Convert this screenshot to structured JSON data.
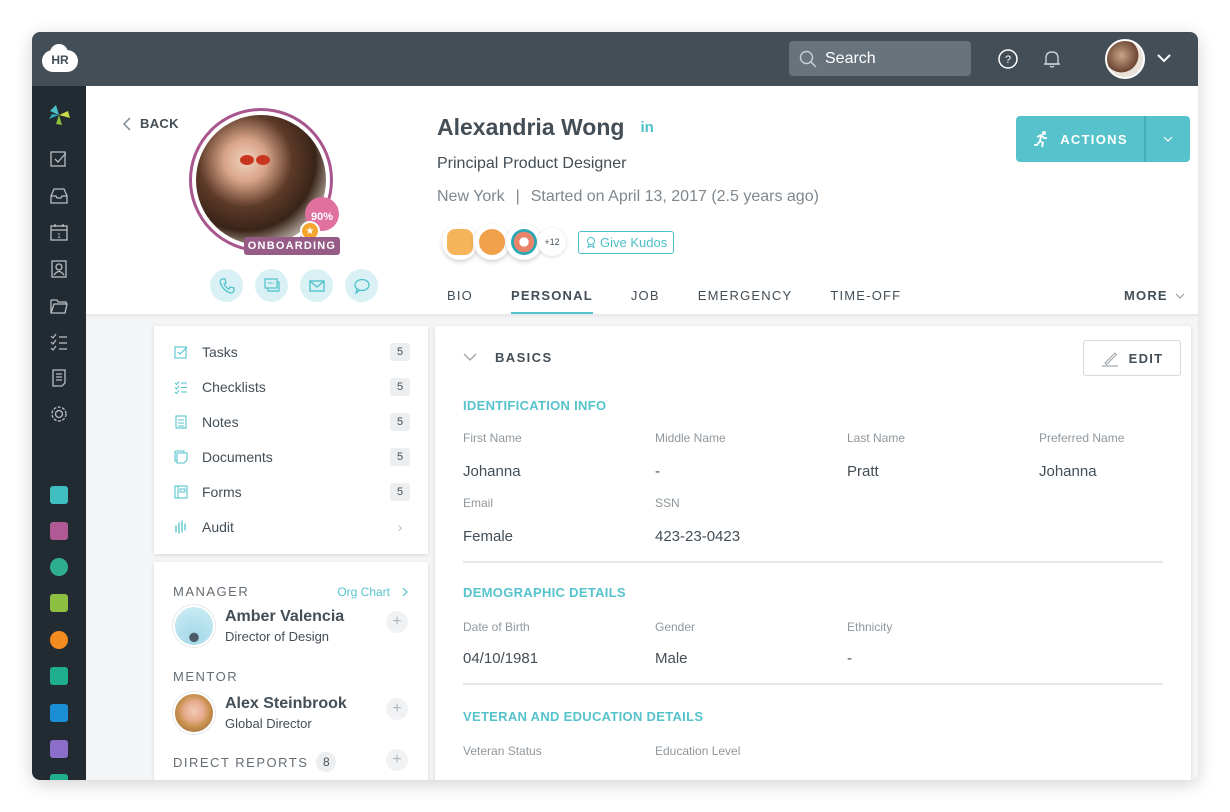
{
  "topbar": {
    "logo_text": "HR",
    "search_placeholder": "Search",
    "icons": [
      "search-icon",
      "help-icon",
      "bell-icon",
      "user-avatar",
      "chevron-down-icon"
    ]
  },
  "sidebar": {
    "nav_icons": [
      "logo-pinwheel-icon",
      "tasks-icon",
      "inbox-icon",
      "calendar-icon",
      "contacts-icon",
      "folder-icon",
      "checklist-icon",
      "document-icon",
      "settings-icon"
    ],
    "apps": [
      {
        "name": "team-app-icon",
        "color": "#3fbfbf"
      },
      {
        "name": "badge-app-icon",
        "color": "#b05a95"
      },
      {
        "name": "award-app-icon",
        "color": "#2fae8e"
      },
      {
        "name": "travel-app-icon",
        "color": "#8cbf3f"
      },
      {
        "name": "health-app-icon",
        "color": "#f38b1f"
      },
      {
        "name": "monitor-app-icon",
        "color": "#1fae8e"
      },
      {
        "name": "search-app-icon",
        "color": "#1b8fd6"
      },
      {
        "name": "report-app-icon",
        "color": "#8a6ec9"
      }
    ]
  },
  "profile": {
    "back_label": "BACK",
    "completion": "90%",
    "status_badge": "ONBOARDING",
    "name": "Alexandria Wong",
    "linkedin": "in",
    "job_title": "Principal Product Designer",
    "location": "New York",
    "separator": "|",
    "start_info": "Started on April 13, 2017 (2.5 years ago)",
    "kudos_more": "+12",
    "give_kudos_label": "Give Kudos",
    "contact_buttons": [
      "phone-icon",
      "chat-icon",
      "mail-icon",
      "message-icon"
    ],
    "actions_label": "ACTIONS"
  },
  "tabs": [
    {
      "label": "BIO",
      "active": false
    },
    {
      "label": "PERSONAL",
      "active": true
    },
    {
      "label": "JOB",
      "active": false
    },
    {
      "label": "EMERGENCY",
      "active": false
    },
    {
      "label": "TIME-OFF",
      "active": false
    }
  ],
  "more_label": "MORE",
  "links": [
    {
      "label": "Tasks",
      "count": "5"
    },
    {
      "label": "Checklists",
      "count": "5"
    },
    {
      "label": "Notes",
      "count": "5"
    },
    {
      "label": "Documents",
      "count": "5"
    },
    {
      "label": "Forms",
      "count": "5"
    },
    {
      "label": "Audit",
      "count": "›"
    }
  ],
  "people": {
    "manager_label": "MANAGER",
    "org_chart_label": "Org Chart",
    "manager": {
      "name": "Amber Valencia",
      "role": "Director of Design"
    },
    "mentor_label": "MENTOR",
    "mentor": {
      "name": "Alex Steinbrook",
      "role": "Global Director"
    },
    "direct_reports_label": "DIRECT REPORTS",
    "direct_reports_count": "8"
  },
  "basics": {
    "title": "BASICS",
    "edit_label": "EDIT",
    "identification": {
      "title": "IDENTIFICATION INFO",
      "row1": [
        {
          "label": "First Name",
          "value": "Johanna"
        },
        {
          "label": "Middle Name",
          "value": "-"
        },
        {
          "label": "Last Name",
          "value": "Pratt"
        },
        {
          "label": "Preferred Name",
          "value": "Johanna"
        }
      ],
      "row2": [
        {
          "label": "Email",
          "value": "Female"
        },
        {
          "label": "SSN",
          "value": "423-23-0423"
        }
      ]
    },
    "demographic": {
      "title": "DEMOGRAPHIC DETAILS",
      "row1": [
        {
          "label": "Date of Birth",
          "value": "04/10/1981"
        },
        {
          "label": "Gender",
          "value": "Male"
        },
        {
          "label": "Ethnicity",
          "value": "-"
        }
      ]
    },
    "veteran": {
      "title": "VETERAN AND EDUCATION DETAILS",
      "row1": [
        {
          "label": "Veteran Status"
        },
        {
          "label": "Education Level"
        }
      ]
    }
  },
  "colors": {
    "accent": "#56c3cc",
    "topbar": "#434e57",
    "sidebar": "#232b32",
    "onboarding": "#965b87",
    "completion": "#e0709e",
    "star": "#f4a52b"
  }
}
